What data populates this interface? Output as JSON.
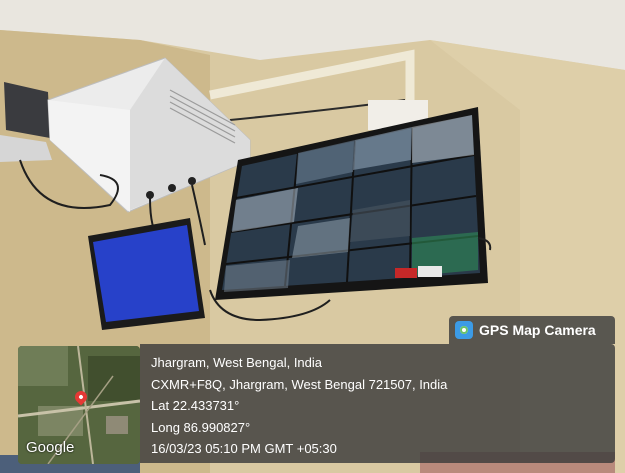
{
  "brand": {
    "label": "GPS Map Camera"
  },
  "map": {
    "google_label": "Google"
  },
  "location": {
    "title": "Jhargram, West Bengal, India",
    "address": "CXMR+F8Q, Jhargram, West Bengal 721507, India",
    "lat": "Lat 22.433731°",
    "long": "Long 86.990827°",
    "timestamp": "16/03/23 05:10 PM GMT +05:30"
  },
  "colors": {
    "wall": "#d8c9a4",
    "ceiling": "#e9e6df",
    "monitor_blue": "#2741c9",
    "overlay_bg": "#3c3c3c",
    "pin": "#e53935"
  }
}
